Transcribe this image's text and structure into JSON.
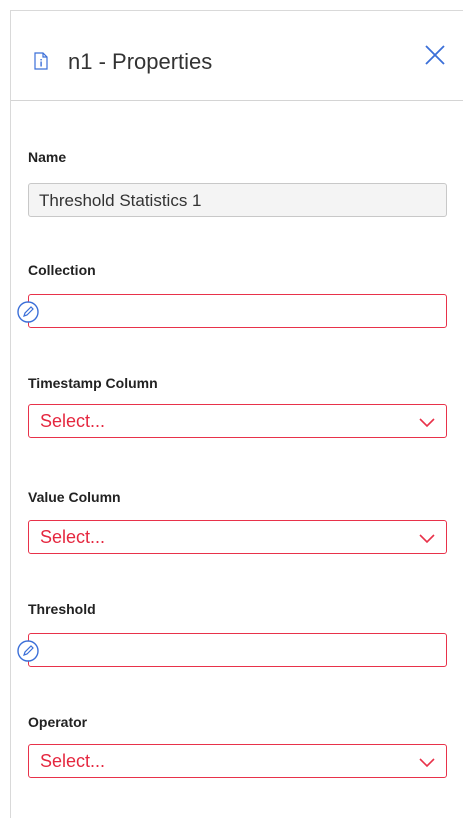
{
  "header": {
    "title": "n1 - Properties",
    "icon": "document-info-icon",
    "close_icon": "close-icon"
  },
  "fields": {
    "name": {
      "label": "Name",
      "value": "Threshold Statistics 1"
    },
    "collection": {
      "label": "Collection",
      "value": ""
    },
    "timestamp_column": {
      "label": "Timestamp Column",
      "placeholder": "Select..."
    },
    "value_column": {
      "label": "Value Column",
      "placeholder": "Select..."
    },
    "threshold": {
      "label": "Threshold",
      "value": ""
    },
    "operator": {
      "label": "Operator",
      "placeholder": "Select..."
    }
  },
  "colors": {
    "error": "#e8324a",
    "accent": "#3b6fd8",
    "border": "#c8c8c8"
  }
}
